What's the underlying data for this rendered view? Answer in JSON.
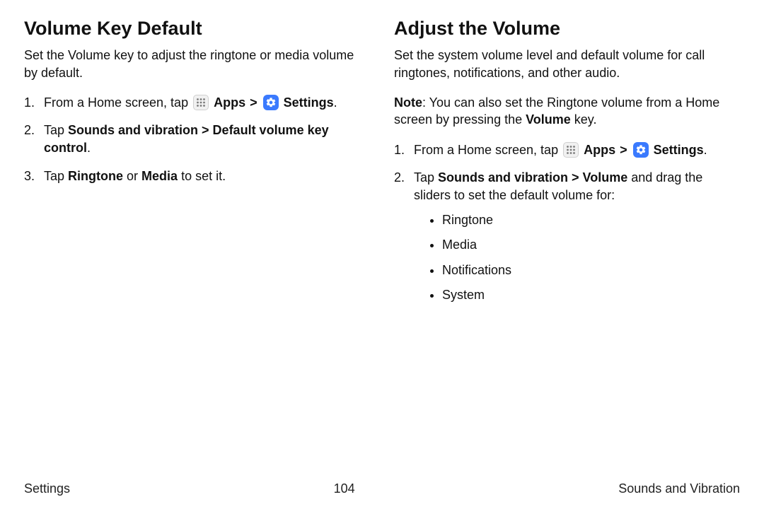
{
  "left": {
    "title": "Volume Key Default",
    "intro": "Set the Volume key to adjust the ringtone or media volume by default.",
    "step1_pre": "From a Home screen, tap ",
    "apps_label": "Apps",
    "settings_label": "Settings",
    "step1_post": ".",
    "step2_pre": "Tap ",
    "step2_bold": "Sounds and vibration > Default volume key control",
    "step2_post": ".",
    "step3_pre": "Tap ",
    "step3_bold1": "Ringtone",
    "step3_mid": " or ",
    "step3_bold2": "Media",
    "step3_post": " to set it."
  },
  "right": {
    "title": "Adjust the Volume",
    "intro": "Set the system volume level and default volume for call ringtones, notifications, and other audio.",
    "note_label": "Note",
    "note_pre": ": You can also set the Ringtone volume from a Home screen by pressing the ",
    "note_bold": "Volume",
    "note_post": " key.",
    "step1_pre": "From a Home screen, tap ",
    "apps_label": "Apps",
    "settings_label": "Settings",
    "step1_post": ".",
    "step2_pre": "Tap ",
    "step2_bold": "Sounds and vibration > Volume",
    "step2_post": " and drag the sliders to set the default volume for:",
    "bullets": {
      "b1": "Ringtone",
      "b2": "Media",
      "b3": "Notifications",
      "b4": "System"
    }
  },
  "footer": {
    "left": "Settings",
    "center": "104",
    "right": "Sounds and Vibration"
  },
  "chevron": ">"
}
